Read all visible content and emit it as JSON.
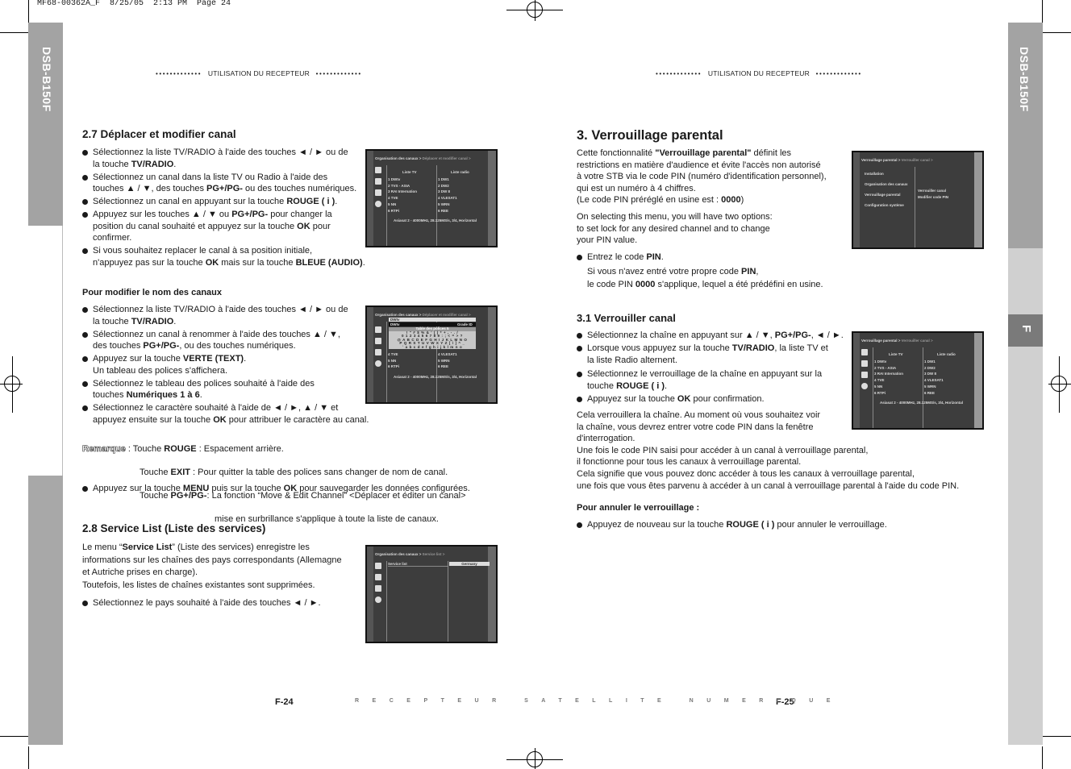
{
  "print_mark": "MF68-00362A_F  8/25/05  2:13 PM  Page 24",
  "model": "DSB-B150F",
  "side_tab": "F",
  "header": {
    "dots": "•••••••••••••",
    "title": "UTILISATION DU RECEPTEUR"
  },
  "footer": {
    "left_page": "F-24",
    "right_page": "F-25",
    "center": "RECEPTEUR SATELLITE NUMERIQUE"
  },
  "left": {
    "s27_title": "2.7 Déplacer et modifier canal",
    "s27_bullets": [
      [
        {
          "t": "Sélectionnez la liste TV/RADIO à l'aide des touches ◄ / ► ou de\nla touche "
        },
        {
          "t": "TV/RADIO",
          "b": 1
        },
        {
          "t": "."
        }
      ],
      [
        {
          "t": "Sélectionnez un canal dans la liste TV  ou Radio à l'aide des\ntouches ▲ / ▼, des touches "
        },
        {
          "t": "PG+/PG-",
          "b": 1
        },
        {
          "t": " ou des touches numériques."
        }
      ],
      [
        {
          "t": "Sélectionnez un canal en appuyant sur la touche "
        },
        {
          "t": "ROUGE ( i )",
          "b": 1
        },
        {
          "t": "."
        }
      ],
      [
        {
          "t": "Appuyez sur les touches ▲ / ▼ ou "
        },
        {
          "t": "PG+/PG-",
          "b": 1
        },
        {
          "t": " pour changer la\nposition du canal souhaité et appuyez sur la touche "
        },
        {
          "t": "OK",
          "b": 1
        },
        {
          "t": " pour\nconfirmer."
        }
      ],
      [
        {
          "t": "Si vous souhaitez replacer le canal à sa position initiale,\nn'appuyez pas sur la touche "
        },
        {
          "t": "OK",
          "b": 1
        },
        {
          "t": " mais sur la touche "
        },
        {
          "t": "BLEUE (AUDIO)",
          "b": 1
        },
        {
          "t": "."
        }
      ]
    ],
    "rename_title": "Pour modifier le nom des canaux",
    "rename_bullets": [
      [
        {
          "t": "Sélectionnez la liste TV/RADIO à l'aide des touches ◄ / ► ou de\nla touche "
        },
        {
          "t": "TV/RADIO",
          "b": 1
        },
        {
          "t": "."
        }
      ],
      [
        {
          "t": "Sélectionnez un canal à renommer à l'aide des touches ▲ / ▼,\ndes touches "
        },
        {
          "t": "PG+/PG-",
          "b": 1
        },
        {
          "t": ", ou des touches numériques."
        }
      ],
      [
        {
          "t": "Appuyez sur la touche "
        },
        {
          "t": "VERTE (TEXT)",
          "b": 1
        },
        {
          "t": ".\nUn tableau des polices s'affichera."
        }
      ],
      [
        {
          "t": "Sélectionnez le tableau des polices souhaité à l'aide des\ntouches "
        },
        {
          "t": "Numériques 1 à 6",
          "b": 1
        },
        {
          "t": "."
        }
      ],
      [
        {
          "t": "Sélectionnez le caractère souhaité à l'aide de ◄ / ►, ▲ / ▼ et\nappuyez ensuite sur la touche "
        },
        {
          "t": "OK",
          "b": 1
        },
        {
          "t": " pour attribuer le caractère au canal."
        }
      ]
    ],
    "remark_label": "Remarque",
    "remark_lines": [
      [
        {
          "t": " : Touche "
        },
        {
          "t": "ROUGE",
          "b": 1
        },
        {
          "t": " : Espacement arrière."
        }
      ],
      [
        {
          "t": "Touche "
        },
        {
          "t": "EXIT",
          "b": 1
        },
        {
          "t": " : Pour quitter la table des polices sans changer de nom de canal."
        }
      ],
      [
        {
          "t": "Touche "
        },
        {
          "t": "PG+/PG-",
          "b": 1
        },
        {
          "t": ": La fonction “Move & Edit Channel” <Déplacer et éditer un canal>"
        }
      ],
      [
        {
          "t": "mise en surbrillance s'applique à toute la liste de canaux."
        }
      ]
    ],
    "save_bullet": [
      [
        {
          "t": "Appuyez sur la touche "
        },
        {
          "t": "MENU",
          "b": 1
        },
        {
          "t": " puis sur la touche "
        },
        {
          "t": "OK",
          "b": 1
        },
        {
          "t": " pour sauvegarder les données configurées."
        }
      ]
    ],
    "s28_title": "2.8 Service List (Liste des services)",
    "s28_para": [
      {
        "t": "Le menu “"
      },
      {
        "t": "Service List",
        "b": 1
      },
      {
        "t": "” (Liste des services) enregistre les\ninformations sur les chaînes des pays correspondants (Allemagne\net Autriche prises en charge).\nToutefois, les listes de chaînes existantes sont supprimées."
      }
    ],
    "s28_bullets": [
      [
        {
          "t": "Sélectionnez le pays souhaité à l'aide des touches ◄ / ►."
        }
      ]
    ]
  },
  "right": {
    "s3_title": "3. Verrouillage parental",
    "s3_para1": [
      {
        "t": "Cette fonctionnalité "
      },
      {
        "t": "\"Verrouillage parental\"",
        "b": 1
      },
      {
        "t": " définit les\nrestrictions en matière d'audience et évite l'accès non autorisé\nà votre STB via le code PIN (numéro d'identification personnel),\nqui est un numéro à 4 chiffres.\n(Le code PIN préréglé en usine est : "
      },
      {
        "t": "0000",
        "b": 1
      },
      {
        "t": ")"
      }
    ],
    "s3_para2": [
      {
        "t": "On selecting this menu, you will have two options:\nto set lock for any desired channel and to change\nyour PIN value."
      }
    ],
    "s3_bullets": [
      [
        {
          "t": "Entrez le code "
        },
        {
          "t": "PIN",
          "b": 1
        },
        {
          "t": "."
        }
      ]
    ],
    "s3_note": [
      {
        "t": "Si vous n'avez entré votre propre code "
      },
      {
        "t": "PIN",
        "b": 1
      },
      {
        "t": ",\nle code PIN "
      },
      {
        "t": "0000",
        "b": 1
      },
      {
        "t": " s'applique, lequel a été prédéfini en usine."
      }
    ],
    "s31_title": "3.1 Verrouiller canal",
    "s31_bullets": [
      [
        {
          "t": "Sélectionnez la chaîne en appuyant sur ▲ / ▼, "
        },
        {
          "t": "PG+/PG-",
          "b": 1
        },
        {
          "t": ", ◄ / ►."
        }
      ],
      [
        {
          "t": "Lorsque vous appuyez sur la touche "
        },
        {
          "t": "TV/RADIO",
          "b": 1
        },
        {
          "t": ", la liste TV et\nla liste Radio alternent."
        }
      ],
      [
        {
          "t": "Sélectionnez le verrouillage de la chaîne en appuyant sur la\ntouche "
        },
        {
          "t": "ROUGE ( i )",
          "b": 1
        },
        {
          "t": "."
        }
      ],
      [
        {
          "t": "Appuyez sur la touche "
        },
        {
          "t": "OK",
          "b": 1
        },
        {
          "t": " pour confirmation."
        }
      ]
    ],
    "s31_para": [
      {
        "t": "Cela verrouillera la chaîne. Au moment où vous souhaitez voir\nla chaîne, vous devrez entrer votre code PIN dans la fenêtre\nd'interrogation.\nUne fois le code PIN saisi pour accéder à un canal à verrouillage parental,\nil fonctionne pour tous les canaux à verrouillage parental.\nCela signifie que vous pouvez donc accéder à tous les canaux à verrouillage parental,\nune fois que vous êtes parvenu à accéder à un canal à verrouillage parental à l'aide du code PIN."
      }
    ],
    "cancel_title": "Pour annuler le verrouillage :",
    "cancel_bullets": [
      [
        {
          "t": "Appuyez de nouveau sur la touche "
        },
        {
          "t": "ROUGE ( i )",
          "b": 1
        },
        {
          "t": " pour annuler le verrouillage."
        }
      ]
    ]
  },
  "screens": {
    "move": {
      "crumb": "Organisation des canaux >",
      "crumb2": "Déplacer et modifier canal >",
      "tv_header": "Liste TV",
      "radio_header": "Liste radio",
      "tv": [
        "1  DWtv",
        "2  TVS - ASIA",
        "3  RAI Internation",
        "4  TVE",
        "5  NN",
        "6  RTPi"
      ],
      "radio": [
        "1  DW1",
        "2  DW2",
        "3  DW 8",
        "4  VLESAT1",
        "5  WRN",
        "6  REE"
      ],
      "status": "Asiasat 2 - 4000MHz, 28.125MS/s, 3/4, Horizontal"
    },
    "font": {
      "crumb": "Organisation des canaux >",
      "crumb2": "Déplacer et modifier canal >",
      "name1": "DWtv",
      "name2": "DWtv",
      "mode": "Grade ID",
      "table_title": "Table des polices 5",
      "rows": [
        "! \" # $ % & ' ( ) * + , - . /",
        "0 1 2 3 4 5 6 7 8 9 : ; < = > ?",
        "@ A B C D E F G H I J K L M N O",
        "P Q R S T U V W X Y Z [ \\ ] ^ _",
        "` a b c d e f g h i j k l m n o"
      ],
      "tv": [
        "4  TVE",
        "5  NN",
        "6  RTPi"
      ],
      "radio": [
        "4  VLESAT1",
        "5  WRN",
        "6  REE"
      ],
      "status": "Asiasat 2 - 4000MHz, 28.125MS/s, 3/4, Horizontal"
    },
    "service": {
      "crumb": "Organisation des canaux >",
      "crumb2": "Service list >",
      "item": "Service list",
      "value": "Germany"
    },
    "menu": {
      "crumb": "Verrouillage parental >",
      "crumb2": "Verrouiller canal >",
      "items": [
        "Installation",
        "Organisation des canaux",
        "Verrouillage parental",
        "Configuration système"
      ],
      "sub": [
        "Verrouiller canal",
        "Modifier code PIN"
      ]
    },
    "lock": {
      "crumb": "Verrouillage parental >",
      "crumb2": "Verrouiller canal >",
      "tv_header": "Liste TV",
      "radio_header": "Liste radio",
      "tv": [
        "1  DWtv",
        "2  TVS - ASIA",
        "3  RAI Internation",
        "4  TVE",
        "5  NN",
        "6  RTPi"
      ],
      "radio": [
        "1  DW1",
        "2  DW2",
        "3  DW 8",
        "4  VLESAT1",
        "5  WRN",
        "6  REE"
      ],
      "status": "Asiasat 2 - 4000MHz, 28.125MS/s, 3/4, Horizontal"
    }
  }
}
